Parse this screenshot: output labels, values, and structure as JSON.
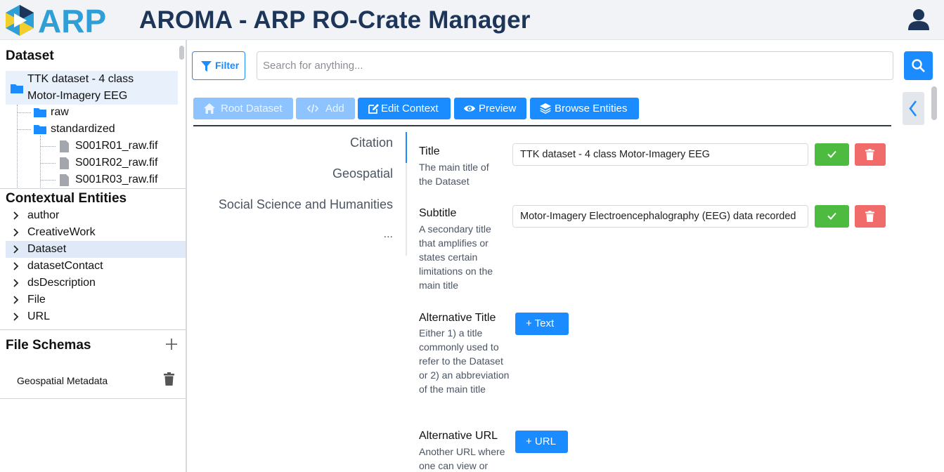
{
  "header": {
    "logo_text": "ARP",
    "title": "AROMA - ARP RO-Crate Manager"
  },
  "colors": {
    "accent": "#1a8cff",
    "brand_dark": "#1c3558",
    "success": "#4cbb3f",
    "danger": "#f26b6b"
  },
  "sidebar": {
    "dataset_title": "Dataset",
    "tree": {
      "root_line1": "TTK dataset - 4 class",
      "root_line2": "Motor-Imagery EEG",
      "folders": [
        "raw",
        "standardized"
      ],
      "files": [
        "S001R01_raw.fif",
        "S001R02_raw.fif",
        "S001R03_raw.fif"
      ]
    },
    "entities_title": "Contextual Entities",
    "entities": [
      "author",
      "CreativeWork",
      "Dataset",
      "datasetContact",
      "dsDescription",
      "File",
      "URL"
    ],
    "active_entity": "Dataset",
    "schemas_title": "File Schemas",
    "schemas": [
      "Geospatial Metadata"
    ]
  },
  "search": {
    "filter_label": "Filter",
    "placeholder": "Search for anything..."
  },
  "toolbar": {
    "root_label": "Root Dataset",
    "add_label": "Add",
    "edit_label": "Edit Context",
    "preview_label": "Preview",
    "browse_label": "Browse Entities"
  },
  "categories": {
    "items": [
      "Citation",
      "Geospatial",
      "Social Science and Humanities",
      "..."
    ],
    "active": "Citation"
  },
  "fields": {
    "title": {
      "label": "Title",
      "desc": "The main title of the Dataset",
      "value": "TTK dataset - 4 class Motor-Imagery EEG"
    },
    "subtitle": {
      "label": "Subtitle",
      "desc": "A secondary title that amplifies or states certain limitations on the main title",
      "value": "Motor-Imagery Electroencephalography (EEG) data recorded"
    },
    "alt_title": {
      "label": "Alternative Title",
      "desc": "Either 1) a title commonly used to refer to the Dataset or 2) an abbreviation of the main title",
      "button": "+ Text"
    },
    "alt_url": {
      "label": "Alternative URL",
      "desc": "Another URL where one can view or",
      "button": "+ URL"
    }
  }
}
